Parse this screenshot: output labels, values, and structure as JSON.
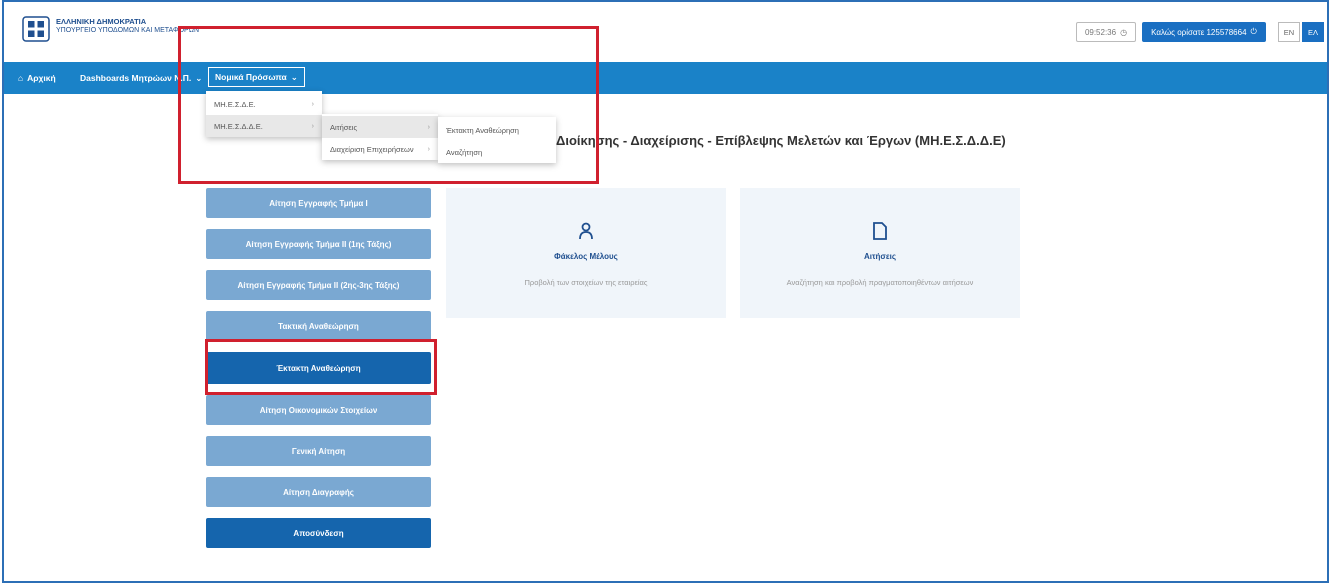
{
  "header": {
    "org_line1": "ΕΛΛΗΝΙΚΗ ΔΗΜΟΚΡΑΤΙΑ",
    "org_line2": "ΥΠΟΥΡΓΕΙΟ ΥΠΟΔΟΜΩΝ ΚΑΙ ΜΕΤΑΦΟΡΩΝ",
    "time": "09:52:36",
    "welcome": "Καλώς ορίσατε 125578664",
    "lang_en": "EN",
    "lang_el": "ΕΛ"
  },
  "nav": {
    "home": "Αρχική",
    "dashboards": "Dashboards Μητρώων Ν.Π.",
    "legal": "Νομικά Πρόσωπα"
  },
  "dropdown_level1": [
    "ΜΗ.Ε.Σ.Δ.Ε.",
    "ΜΗ.Ε.Σ.Δ.Δ.Ε."
  ],
  "dropdown_level2": [
    "Αιτήσεις",
    "Διαχείριση Επιχειρήσεων"
  ],
  "dropdown_level3": [
    "Έκτακτη Αναθεώρηση",
    "Αναζήτηση"
  ],
  "page_title": "Διοίκησης - Διαχείρισης - Επίβλεψης Μελετών και Έργων (ΜΗ.Ε.Σ.Δ.Δ.Ε)",
  "sidebar": [
    "Αίτηση Εγγραφής Τμήμα Ι",
    "Αίτηση Εγγραφής Τμήμα ΙΙ (1ης Τάξης)",
    "Αίτηση Εγγραφής Τμήμα ΙΙ (2ης-3ης Τάξης)",
    "Τακτική Αναθεώρηση",
    "Έκτακτη Αναθεώρηση",
    "Αίτηση Οικονομικών Στοιχείων",
    "Γενική Αίτηση",
    "Αίτηση Διαγραφής",
    "Αποσύνδεση"
  ],
  "cards": [
    {
      "title": "Φάκελος Μέλους",
      "desc": "Προβολή των στοιχείων της εταιρείας",
      "icon": "user-icon"
    },
    {
      "title": "Αιτήσεις",
      "desc": "Αναζήτηση και προβολή πραγματοποιηθέντων αιτήσεων",
      "icon": "document-icon"
    }
  ]
}
